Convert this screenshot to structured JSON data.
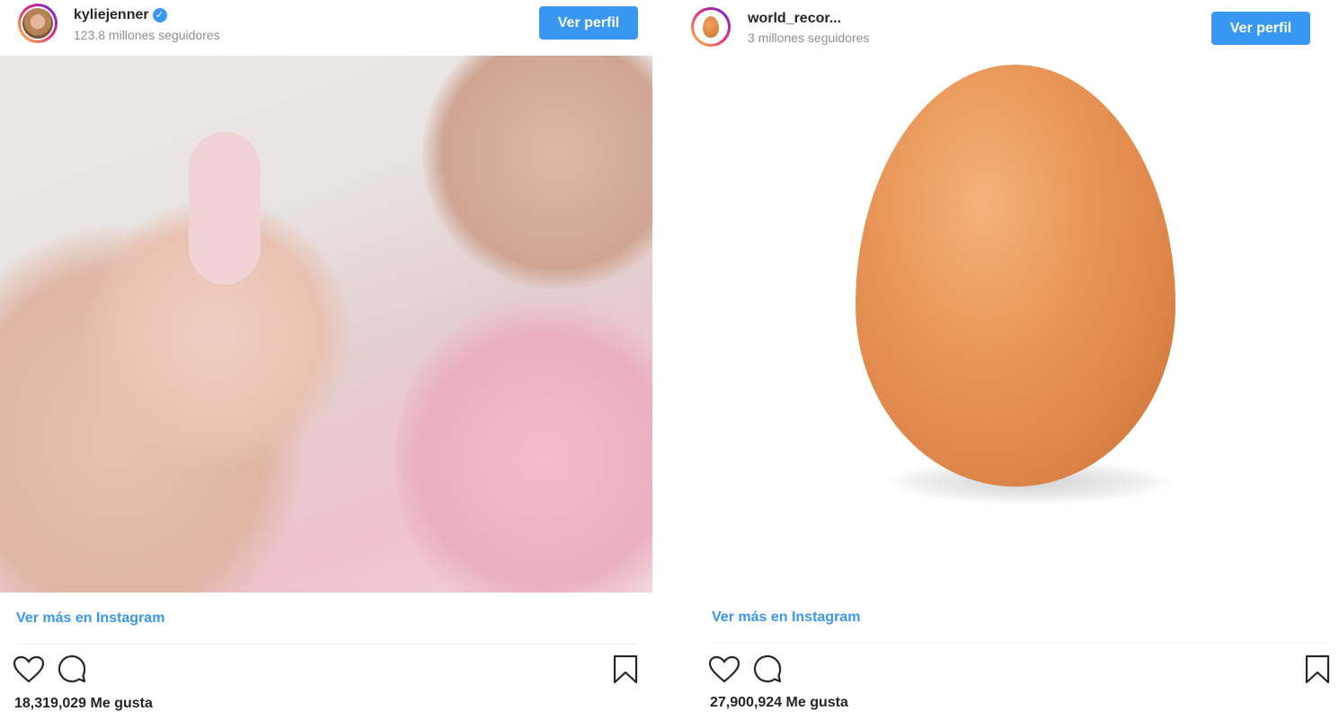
{
  "posts": [
    {
      "username": "kyliejenner",
      "verified": true,
      "followers": "123.8 millones seguidores",
      "profile_button": "Ver perfil",
      "view_more": "Ver más en Instagram",
      "likes": "18,319,029 Me gusta",
      "verified_icon": "checkmark-badge-icon"
    },
    {
      "username": "world_recor...",
      "verified": false,
      "followers": "3 millones seguidores",
      "profile_button": "Ver perfil",
      "view_more": "Ver más en Instagram",
      "likes": "27,900,924 Me gusta"
    }
  ],
  "icons": {
    "like": "heart-icon",
    "comment": "comment-bubble-icon",
    "save": "bookmark-icon"
  },
  "colors": {
    "accent": "#3897f0",
    "text": "#262626",
    "muted": "#8e8e8e"
  }
}
